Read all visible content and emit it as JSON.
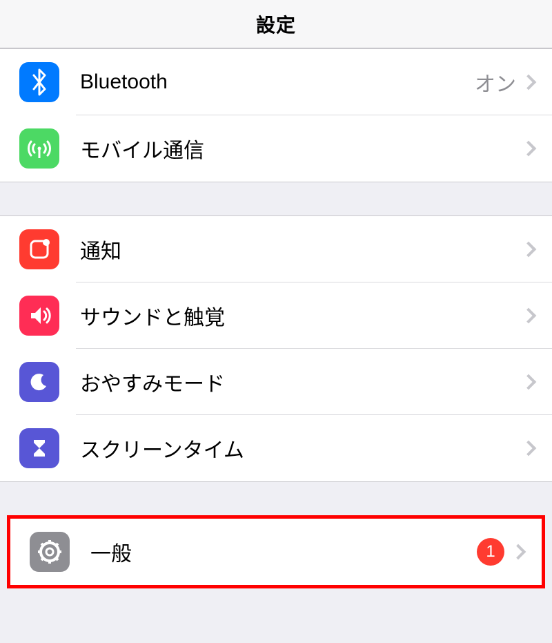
{
  "header": {
    "title": "設定"
  },
  "groups": [
    {
      "rows": [
        {
          "icon": "bluetooth",
          "label": "Bluetooth",
          "value": "オン"
        },
        {
          "icon": "cellular",
          "label": "モバイル通信"
        }
      ]
    },
    {
      "rows": [
        {
          "icon": "notifications",
          "label": "通知"
        },
        {
          "icon": "sounds",
          "label": "サウンドと触覚"
        },
        {
          "icon": "dnd",
          "label": "おやすみモード"
        },
        {
          "icon": "screentime",
          "label": "スクリーンタイム"
        }
      ]
    },
    {
      "highlighted": true,
      "rows": [
        {
          "icon": "general",
          "label": "一般",
          "badge": "1"
        }
      ]
    }
  ]
}
